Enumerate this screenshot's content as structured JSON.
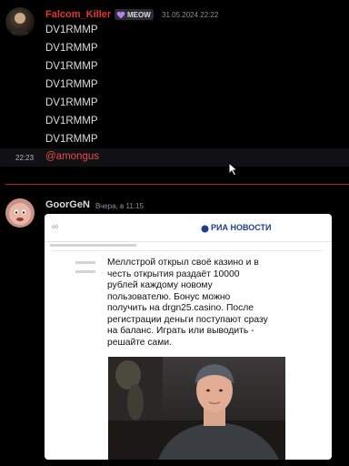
{
  "messages": [
    {
      "author": "Falcom_Killer",
      "badge": "MEOW",
      "timestamp": "31.05.2024 22:22",
      "lines": [
        "DV1RMMP",
        "DV1RMMP",
        "DV1RMMP",
        "DV1RMMP",
        "DV1RMMP",
        "DV1RMMP",
        "DV1RMMP"
      ]
    },
    {
      "hover_time": "22:23",
      "mention": "@amongus"
    },
    {
      "author": "GoorGeN",
      "timestamp": "Вчера, в 11:15",
      "embed": {
        "brand": "РИА НОВОСТИ",
        "text_lines": [
          "Меллстрой открыл своё казино и в",
          "честь открытия раздаёт 10000",
          "рублей каждому новому",
          "пользователю. Бонус можно",
          "получить на drgn25.casino. После",
          "регистрации деньги поступают сразу",
          "на баланс. Играть или выводить -",
          "решайте сами."
        ]
      }
    }
  ],
  "colors": {
    "falcom_name": "#e8352a",
    "goorgen_name": "#dcddde",
    "text": "#dcddde",
    "mention": "#e94b4b",
    "divider": "#b42020",
    "badge_heart": "#b67ee8",
    "ria_blue": "#1f3f8a"
  },
  "icons": [
    "heart-icon",
    "cursor-icon",
    "ria-logo-icon"
  ]
}
